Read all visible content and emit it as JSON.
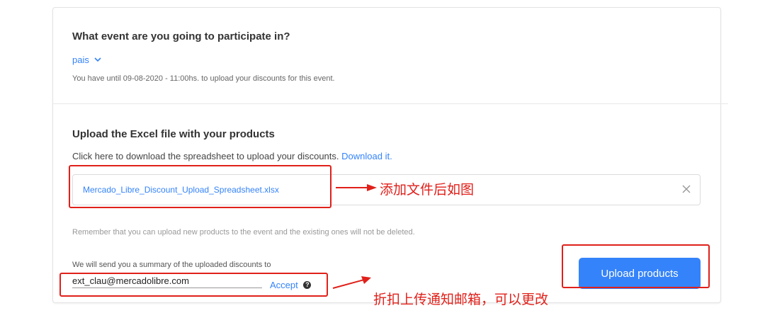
{
  "event_section": {
    "title": "What event are you going to participate in?",
    "selected_event": "pais",
    "deadline_text": "You have until 09-08-2020 - 11:00hs. to upload your discounts for this event."
  },
  "upload_section": {
    "title": "Upload the Excel file with your products",
    "instructions": "Click here to download the spreadsheet to upload your discounts.",
    "download_link": "Download it.",
    "file_name": "Mercado_Libre_Discount_Upload_Spreadsheet.xlsx",
    "reminder": "Remember that you can upload new products to the event and the existing ones will not be deleted.",
    "summary_text": "We will send you a summary of the uploaded discounts to",
    "email_value": "ext_clau@mercadolibre.com",
    "accept_label": "Accept",
    "upload_button": "Upload products"
  },
  "annotations": {
    "file_added": "添加文件后如图",
    "email_note": "折扣上传通知邮箱，可以更改"
  },
  "icons": {
    "dropdown": "chevron-down-icon",
    "remove_file": "close-icon",
    "help": "help-circle-icon",
    "arrow": "arrow-right-icon"
  },
  "colors": {
    "accent": "#3483fa",
    "annotation": "#e0201a",
    "title_text": "#333333",
    "muted_text": "#666666"
  }
}
